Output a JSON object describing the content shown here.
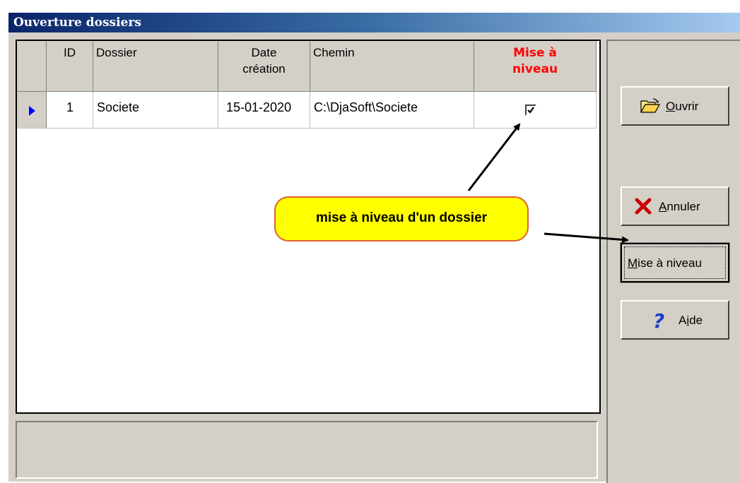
{
  "window": {
    "title": "Ouverture dossiers"
  },
  "grid": {
    "headers": {
      "id": "ID",
      "dossier": "Dossier",
      "date_line1": "Date",
      "date_line2": "création",
      "chemin": "Chemin",
      "mise_line1": "Mise à",
      "mise_line2": "niveau"
    },
    "rows": [
      {
        "id": "1",
        "dossier": "Societe",
        "date": "15-01-2020",
        "chemin": "C:\\DjaSoft\\Societe",
        "mise_a_niveau": true
      }
    ]
  },
  "buttons": {
    "ouvrir": {
      "mnemonic": "O",
      "rest": "uvrir"
    },
    "annuler": {
      "mnemonic": "A",
      "rest": "nnuler"
    },
    "mise": {
      "mnemonic": "M",
      "rest": "ise à niveau"
    },
    "aide": {
      "pre": "A",
      "mnemonic": "i",
      "rest": "de"
    }
  },
  "callout": {
    "text": "mise à niveau d'un dossier"
  },
  "colors": {
    "highlight_header": "#ff0000",
    "callout_fill": "#ffff00",
    "callout_border": "#e06030",
    "row_indicator": "#0000ff"
  },
  "icons": {
    "ouvrir": "open-folder-icon",
    "annuler": "red-x-icon",
    "aide": "question-mark-icon",
    "row": "row-pointer-icon"
  }
}
